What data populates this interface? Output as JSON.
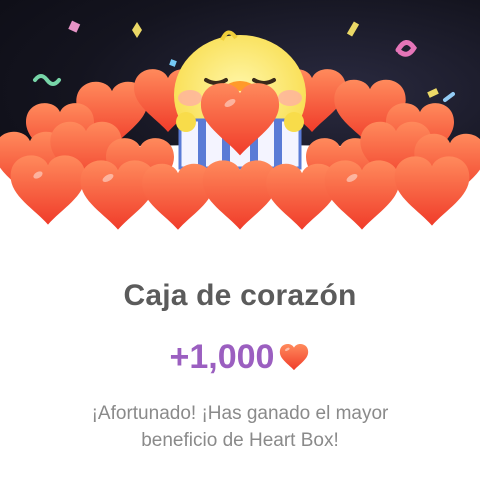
{
  "card": {
    "title": "Caja de corazón",
    "reward_amount": "+1,000",
    "reward_icon": "heart-icon",
    "message": "¡Afortunado! ¡Has ganado el mayor beneficio de Heart Box!"
  },
  "colors": {
    "title": "#5b5b5b",
    "reward": "#9b5fc0",
    "message": "#8a8a8a",
    "heart": "#ff5a3c"
  }
}
